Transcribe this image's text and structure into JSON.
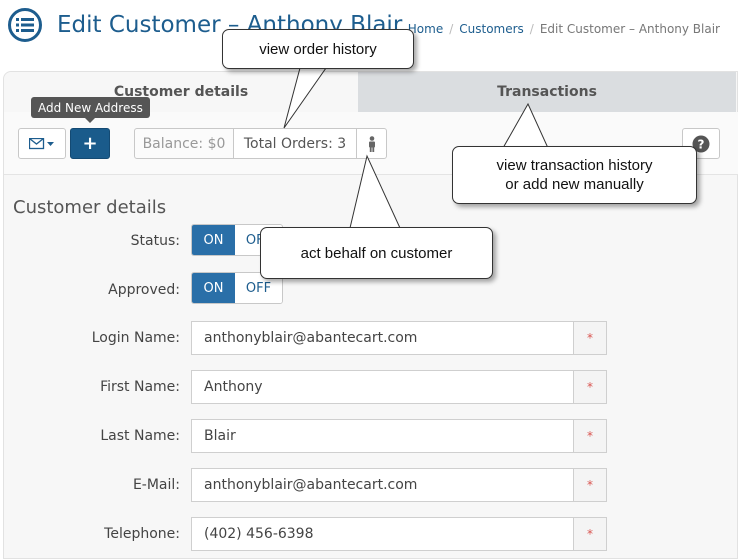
{
  "header": {
    "title": "Edit Customer – Anthony Blair",
    "icon": "list-icon",
    "breadcrumb": {
      "home": "Home",
      "customers": "Customers",
      "current": "Edit Customer – Anthony Blair"
    }
  },
  "tabs": [
    {
      "label": "Customer details",
      "active": true
    },
    {
      "label": "Transactions",
      "active": false
    }
  ],
  "toolbar": {
    "mail_icon": "envelope-icon",
    "add_tooltip": "Add New Address",
    "add_label": "+",
    "balance": "Balance: $0",
    "total_orders": "Total Orders: 3",
    "actas_icon": "person-icon",
    "help_label": "?"
  },
  "callouts": {
    "order_history": "view order history",
    "transactions": "view transaction history\nor add new manually",
    "act_behalf": "act behalf on customer"
  },
  "form": {
    "section_title": "Customer details",
    "status": {
      "label": "Status:",
      "on": "ON",
      "off": "OFF"
    },
    "approved": {
      "label": "Approved:",
      "on": "ON",
      "off": "OFF"
    },
    "fields": [
      {
        "label": "Login Name:",
        "value": "anthonyblair@abantecart.com"
      },
      {
        "label": "First Name:",
        "value": "Anthony"
      },
      {
        "label": "Last Name:",
        "value": "Blair"
      },
      {
        "label": "E-Mail:",
        "value": "anthonyblair@abantecart.com"
      },
      {
        "label": "Telephone:",
        "value": "(402) 456-6398"
      }
    ],
    "required_mark": "*"
  },
  "colors": {
    "brand": "#1d5d8e",
    "switch_on": "#2a6fa8",
    "required": "#d9534f"
  }
}
